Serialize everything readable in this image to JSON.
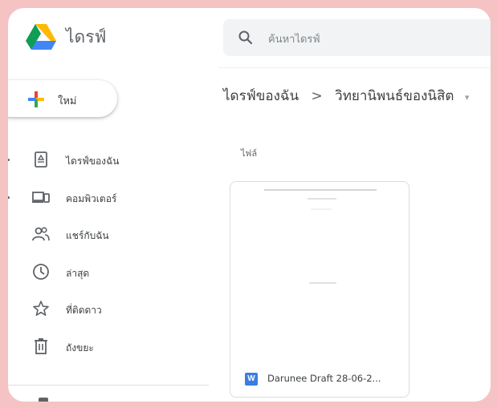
{
  "header": {
    "app_title": "ไดรฟ์",
    "search_placeholder": "ค้นหาไดรฟ์"
  },
  "new_button": {
    "label": "ใหม่"
  },
  "sidebar": {
    "items": [
      {
        "label": "ไดรฟ์ของฉัน",
        "icon": "my-drive-icon"
      },
      {
        "label": "คอมพิวเตอร์",
        "icon": "computers-icon"
      },
      {
        "label": "แชร์กับฉัน",
        "icon": "shared-with-me-icon"
      },
      {
        "label": "ล่าสุด",
        "icon": "clock-icon"
      },
      {
        "label": "ที่ติดดาว",
        "icon": "star-icon"
      },
      {
        "label": "ถังขยะ",
        "icon": "trash-icon"
      }
    ]
  },
  "breadcrumb": {
    "root": "ไดรฟ์ของฉัน",
    "separator": ">",
    "current": "วิทยานิพนธ์ของนิสิต",
    "caret": "▾"
  },
  "main": {
    "section_label": "ไฟล์",
    "files": [
      {
        "name": "Darunee Draft 28-06-2...",
        "type_badge": "W",
        "icon": "word-doc-icon"
      }
    ]
  },
  "colors": {
    "background": "#f6c3c5",
    "search_bg": "#f1f3f4",
    "word_blue": "#3b7de3",
    "text_primary": "#3c4043",
    "text_secondary": "#5f6368"
  }
}
